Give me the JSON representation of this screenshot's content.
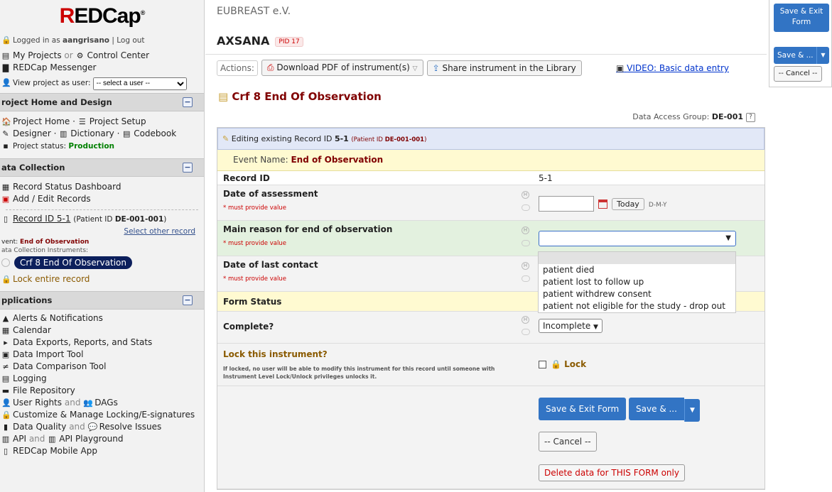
{
  "app": {
    "logo": "REDCap",
    "logo_mark": "®"
  },
  "sidebar": {
    "logged_prefix": "Logged in as",
    "username": "aangrisano",
    "logout": "Log out",
    "my_projects": "My Projects",
    "or": "or",
    "control_center": "Control Center",
    "messenger": "REDCap Messenger",
    "view_as_label": "View project as user:",
    "view_as_value": "-- select a user --",
    "sec_home": "roject Home and Design",
    "project_home": "Project Home",
    "project_setup": "Project Setup",
    "designer": "Designer",
    "dictionary": "Dictionary",
    "codebook": "Codebook",
    "status_label": "Project status:",
    "status_value": "Production",
    "sec_data": "ata Collection",
    "record_status_dashboard": "Record Status Dashboard",
    "add_edit_records": "Add / Edit Records",
    "record_label": "Record ID 5-1",
    "patient_prefix": "(Patient ID",
    "patient_id": "DE-001-001",
    "patient_suffix": ")",
    "select_other": "Select other record",
    "event_label": "vent:",
    "event_value": "End of Observation",
    "instruments_label": "ata Collection Instruments:",
    "instrument": "Crf 8 End Of Observation",
    "lock_entire": "Lock entire record",
    "sec_apps": "pplications",
    "apps": [
      "Alerts & Notifications",
      "Calendar",
      "Data Exports, Reports, and Stats",
      "Data Import Tool",
      "Data Comparison Tool",
      "Logging",
      "File Repository"
    ],
    "user_rights": "User Rights",
    "and": "and",
    "dags": "DAGs",
    "customize_locking": "Customize & Manage Locking/E-signatures",
    "data_quality": "Data Quality",
    "resolve_issues": "Resolve Issues",
    "api": "API",
    "api_playground": "API Playground",
    "mobile_app": "REDCap Mobile App"
  },
  "header": {
    "org": "EUBREAST e.V.",
    "project": "AXSANA",
    "pid": "PID 17"
  },
  "actions": {
    "label": "Actions:",
    "download_pdf": "Download PDF of instrument(s)",
    "share": "Share instrument in the Library",
    "video": "VIDEO: Basic data entry"
  },
  "form": {
    "title": "Crf 8 End Of Observation",
    "dag_label": "Data Access Group:",
    "dag_value": "DE-001",
    "help": "?",
    "editing_prefix": "Editing existing Record ID",
    "record_id": "5-1",
    "patient_prefix": "(Patient ID",
    "patient_id": "DE-001-001",
    "patient_suffix": ")",
    "event_prefix": "Event Name:",
    "event_name": "End of Observation",
    "record_id_label": "Record ID",
    "record_id_value": "5-1",
    "date_assessment_label": "Date of assessment",
    "must": "* must provide value",
    "today": "Today",
    "date_fmt": "D-M-Y",
    "main_reason_label": "Main reason for end of observation",
    "main_reason_value": "",
    "main_reason_options": [
      "",
      "patient died",
      "patient lost to follow up",
      "patient withdrew consent",
      "patient not eligible for the study - drop out"
    ],
    "last_contact_label": "Date of last contact",
    "form_status_header": "Form Status",
    "complete_label": "Complete?",
    "complete_value": "Incomplete",
    "lock_label": "Lock this instrument?",
    "lock_desc": "If locked, no user will be able to modify this instrument for this record until someone with Instrument Level Lock/Unlock privileges unlocks it.",
    "lock_checkbox": "Lock",
    "save_exit": "Save & Exit Form",
    "save_more": "Save & ...",
    "cancel": "-- Cancel --",
    "delete": "Delete data for THIS FORM only"
  },
  "floating": {
    "save_exit_line1": "Save & Exit",
    "save_exit_line2": "Form",
    "save_more": "Save & ...",
    "cancel": "-- Cancel --"
  },
  "colors": {
    "accent": "#3274c4",
    "brand_red": "#c00000",
    "title": "#800000",
    "edit_row": "#e2e8f7",
    "event_row": "#fffad1",
    "green_row": "#e3f1df"
  }
}
